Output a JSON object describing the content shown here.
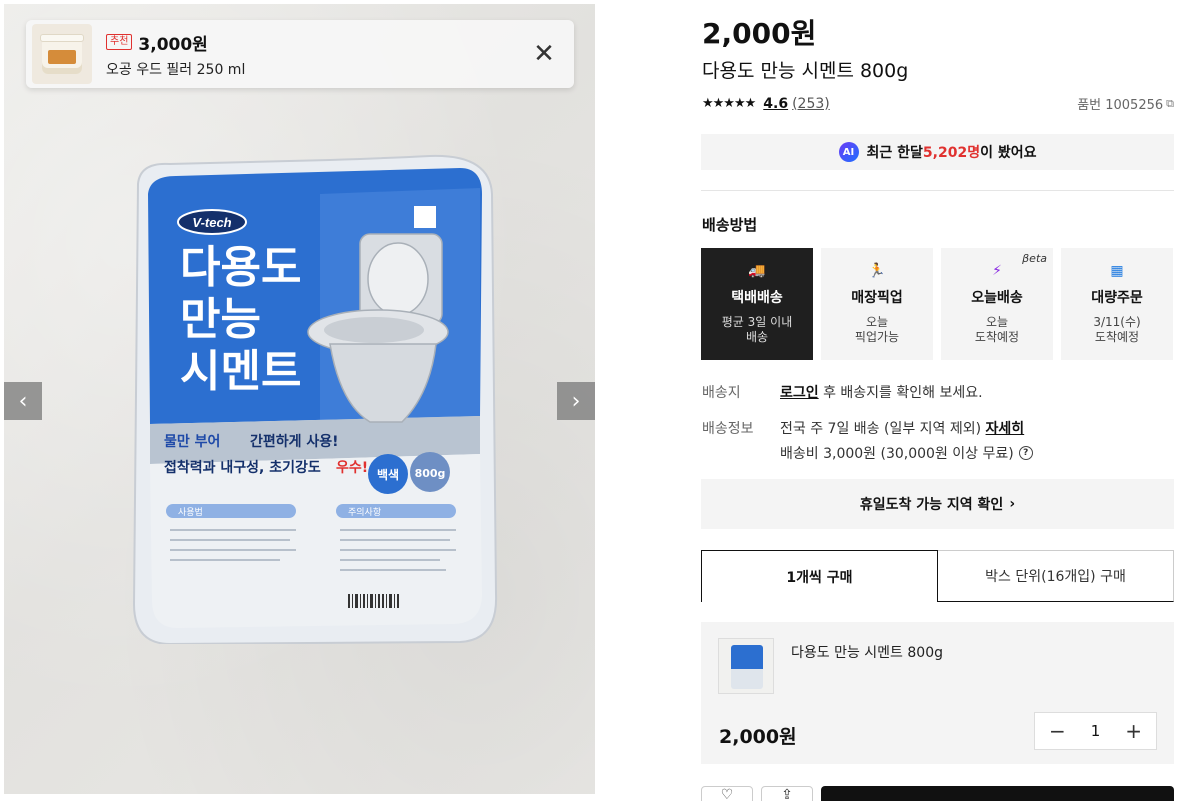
{
  "recommendation": {
    "badge": "추천",
    "price": "3,000원",
    "name": "오공 우드 필러 250 ml"
  },
  "gallery": {
    "package": {
      "brand": "V-tech",
      "title_lines": [
        "다용도",
        "만능",
        "시멘트"
      ],
      "feature_1_prefix": "물만 부어 ",
      "feature_1": "간편하게 사용!",
      "feature_2": "접착력과 내구성, 초기강도",
      "feature_2_hl": " 우수!",
      "color_badge": "백색",
      "weight_badge": "800g",
      "section_usage": "사용법",
      "section_caution": "주의사항"
    }
  },
  "product": {
    "price": "2,000원",
    "title": "다용도 만능 시멘트 800g",
    "stars": "★★★★★",
    "rating": "4.6",
    "review_count": "(253)",
    "sku_label": "품번 1005256"
  },
  "ai_notice": {
    "badge": "AI",
    "prefix": "최근 한달 ",
    "highlight": "5,202명",
    "suffix": "이 봤어요"
  },
  "shipping": {
    "heading": "배송방법",
    "options": [
      {
        "icon": "truck-icon",
        "name": "택배배송",
        "sub1": "평균 3일 이내",
        "sub2": "배송",
        "active": true
      },
      {
        "icon": "runner-icon",
        "name": "매장픽업",
        "sub1": "오늘",
        "sub2": "픽업가능",
        "active": false
      },
      {
        "icon": "bolt-truck-icon",
        "name": "오늘배송",
        "sub1": "오늘",
        "sub2": "도착예정",
        "beta": "βeta",
        "active": false
      },
      {
        "icon": "box-icon",
        "name": "대량주문",
        "sub1": "3/11(수)",
        "sub2": "도착예정",
        "active": false
      }
    ],
    "dest_label": "배송지",
    "dest_login": "로그인",
    "dest_text": " 후 배송지를 확인해 보세요.",
    "info_label": "배송정보",
    "info_text": "전국 주 7일 배송 (일부 지역 제외) ",
    "info_link": "자세히",
    "fee_text": "배송비 3,000원 (30,000원 이상 무료)",
    "holiday_button": "휴일도착 가능 지역 확인"
  },
  "purchase_tabs": {
    "tab_single": "1개씩 구매",
    "tab_box": "박스 단위(16개입) 구매"
  },
  "cart": {
    "item_name": "다용도 만능 시멘트 800g",
    "price": "2,000원",
    "quantity": "1"
  },
  "colors": {
    "accent_red": "#e0312f",
    "active_dark": "#1f1f1f",
    "panel_gray": "#f4f4f4",
    "package_blue": "#2c6fd0"
  }
}
